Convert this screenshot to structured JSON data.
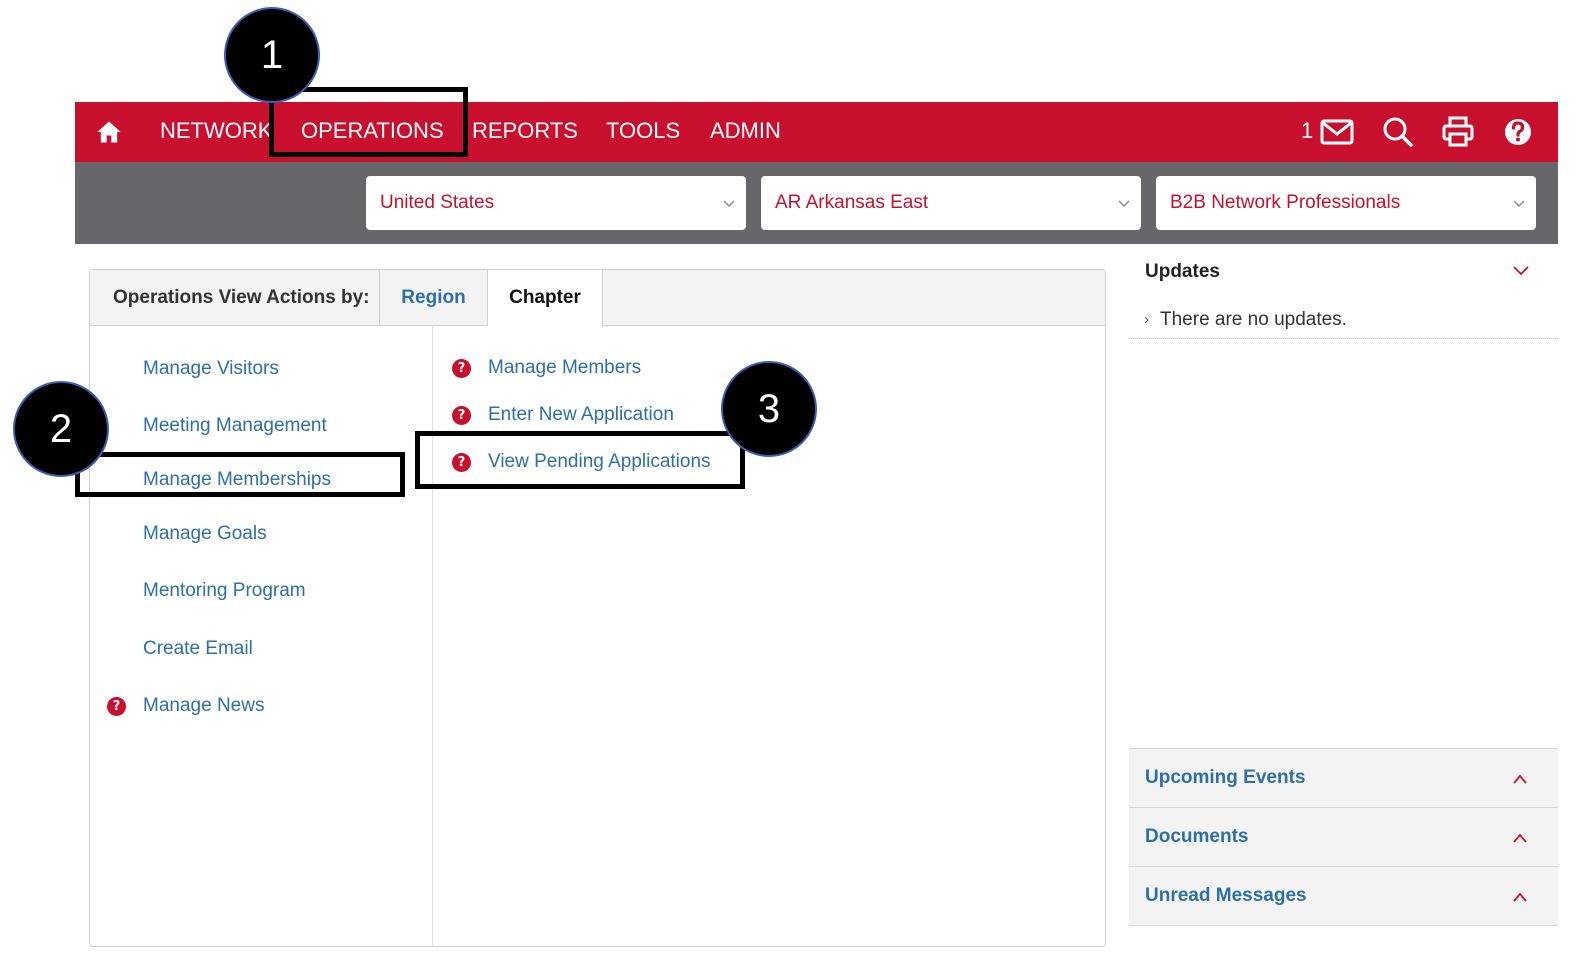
{
  "nav": {
    "items": [
      "NETWORK",
      "OPERATIONS",
      "REPORTS",
      "TOOLS",
      "ADMIN"
    ],
    "mail_count": "1",
    "icons": [
      "home-icon",
      "mail-icon",
      "search-icon",
      "print-icon",
      "help-icon"
    ]
  },
  "filters": {
    "country": "United States",
    "region": "AR Arkansas East",
    "chapter": "B2B Network Professionals"
  },
  "operations": {
    "caption": "Operations View Actions by:",
    "tabs": [
      "Region",
      "Chapter"
    ],
    "active_tab": "Chapter",
    "left_links": [
      "Manage Visitors",
      "Meeting Management",
      "Manage Memberships",
      "Manage Goals",
      "Mentoring Program",
      "Create Email",
      "Manage News"
    ],
    "right_links": [
      "Manage Members",
      "Enter New Application",
      "View Pending Applications"
    ]
  },
  "side": {
    "updates_title": "Updates",
    "updates_empty": "There are no updates.",
    "sections": [
      "Upcoming Events",
      "Documents",
      "Unread Messages"
    ]
  },
  "steps": [
    "1",
    "2",
    "3"
  ],
  "colors": {
    "brand_red": "#c8102e",
    "link_blue": "#2e6fa6",
    "filter_gray": "#67676b"
  }
}
